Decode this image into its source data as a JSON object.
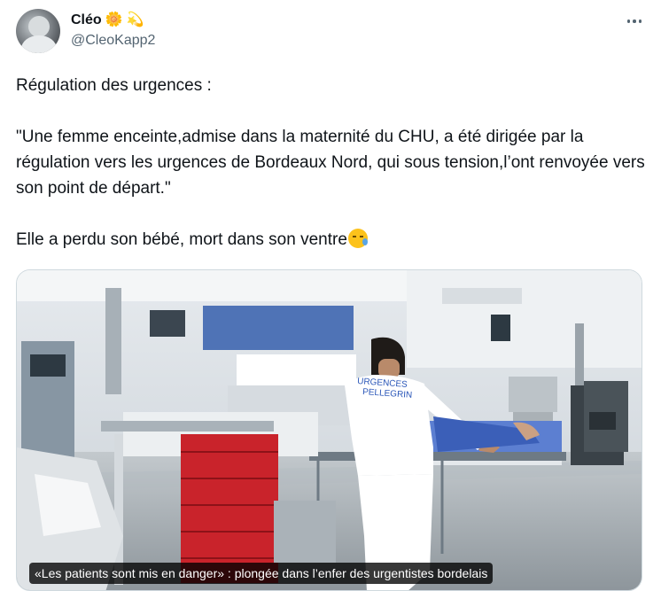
{
  "author": {
    "display_name": "Cléo",
    "name_emojis": [
      "🌼",
      "💫"
    ],
    "handle": "@CleoKapp2"
  },
  "tweet": {
    "lines": [
      "Régulation des urgences :",
      "",
      "\"Une femme enceinte,admise dans la maternité du CHU, a été dirigée par la régulation vers les urgences de Bordeaux Nord, qui sous tension,l’ont renvoyée vers son point de départ.\"",
      "",
      "Elle a perdu son bébé, mort dans son ventre"
    ],
    "end_emoji": "crying-face-icon"
  },
  "media": {
    "scrub_label": "URGENCES PELLEGRIN",
    "card_title": "«Les patients sont mis en danger» : plongée dans l’enfer des urgentistes bordelais"
  },
  "colors": {
    "text": "#0f1419",
    "secondary": "#536471",
    "border": "#cfd9de"
  }
}
